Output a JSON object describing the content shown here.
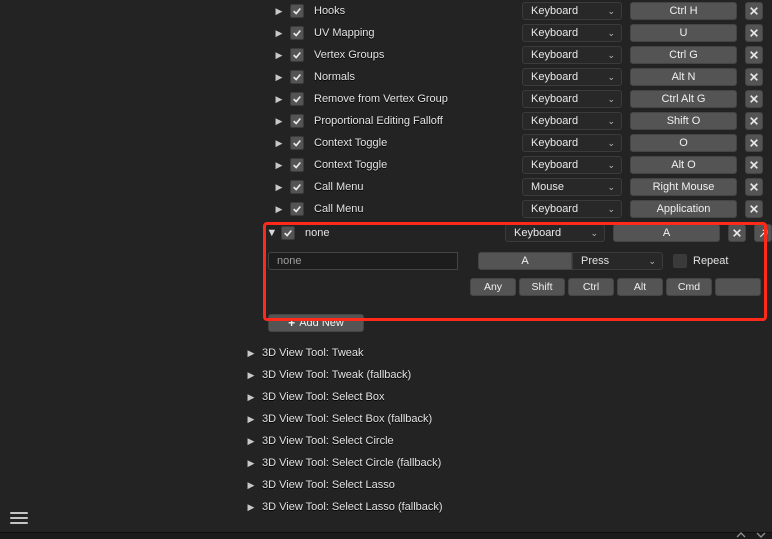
{
  "rows": [
    {
      "label": "Hooks",
      "type": "Keyboard",
      "shortcut": "Ctrl H"
    },
    {
      "label": "UV Mapping",
      "type": "Keyboard",
      "shortcut": "U"
    },
    {
      "label": "Vertex Groups",
      "type": "Keyboard",
      "shortcut": "Ctrl G"
    },
    {
      "label": "Normals",
      "type": "Keyboard",
      "shortcut": "Alt N"
    },
    {
      "label": "Remove from Vertex Group",
      "type": "Keyboard",
      "shortcut": "Ctrl Alt G"
    },
    {
      "label": "Proportional Editing Falloff",
      "type": "Keyboard",
      "shortcut": "Shift O"
    },
    {
      "label": "Context Toggle",
      "type": "Keyboard",
      "shortcut": "O"
    },
    {
      "label": "Context Toggle",
      "type": "Keyboard",
      "shortcut": "Alt O"
    },
    {
      "label": "Call Menu",
      "type": "Mouse",
      "shortcut": "Right Mouse"
    },
    {
      "label": "Call Menu",
      "type": "Keyboard",
      "shortcut": "Application"
    }
  ],
  "expanded": {
    "label": "none",
    "type": "Keyboard",
    "shortcut": "A",
    "operator_text": "none",
    "key": "A",
    "event": "Press",
    "repeat_label": "Repeat",
    "mods": [
      "Any",
      "Shift",
      "Ctrl",
      "Alt",
      "Cmd"
    ]
  },
  "add_button": "Add New",
  "tree": [
    "3D View Tool: Tweak",
    "3D View Tool: Tweak (fallback)",
    "3D View Tool: Select Box",
    "3D View Tool: Select Box (fallback)",
    "3D View Tool: Select Circle",
    "3D View Tool: Select Circle (fallback)",
    "3D View Tool: Select Lasso",
    "3D View Tool: Select Lasso (fallback)"
  ]
}
